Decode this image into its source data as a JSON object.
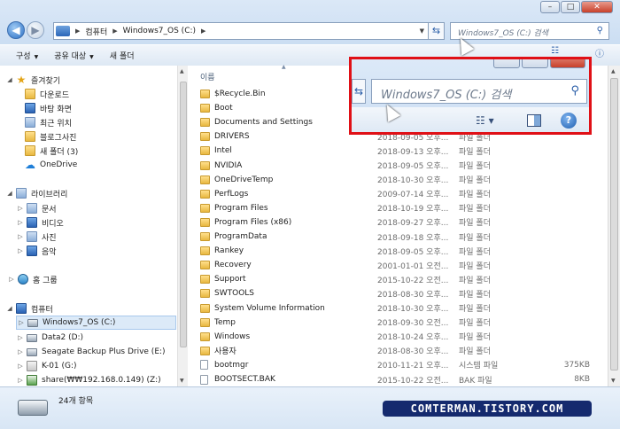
{
  "address_bar": {
    "segments": [
      "컴퓨터",
      "Windows7_OS (C:)"
    ]
  },
  "search": {
    "placeholder": "Windows7_OS (C:) 검색"
  },
  "toolbar": {
    "organize": "구성",
    "share": "공유 대상",
    "new_folder": "새 폴더"
  },
  "sidebar": {
    "favorites_header": "즐겨찾기",
    "favorites": [
      "다운로드",
      "바탕 화면",
      "최근 위치",
      "블로그사진",
      "새 폴더 (3)",
      "OneDrive"
    ],
    "libraries_header": "라이브러리",
    "libraries": [
      "문서",
      "비디오",
      "사진",
      "음악"
    ],
    "homegroup": "홈 그룹",
    "computer_header": "컴퓨터",
    "drives": [
      "Windows7_OS (C:)",
      "Data2 (D:)",
      "Seagate Backup Plus Drive (E:)",
      "K-01 (G:)",
      "share(₩₩192.168.0.149) (Z:)"
    ]
  },
  "file_list": {
    "column_name": "이름",
    "rows": [
      {
        "name": "$Recycle.Bin",
        "date": "",
        "type": "",
        "size": ""
      },
      {
        "name": "Boot",
        "date": "",
        "type": "",
        "size": ""
      },
      {
        "name": "Documents and Settings",
        "date": "",
        "type": "",
        "size": ""
      },
      {
        "name": "DRIVERS",
        "date": "2018-09-05 오후...",
        "type": "파일 폴더",
        "size": ""
      },
      {
        "name": "Intel",
        "date": "2018-09-13 오후...",
        "type": "파일 폴더",
        "size": ""
      },
      {
        "name": "NVIDIA",
        "date": "2018-09-05 오후...",
        "type": "파일 폴더",
        "size": ""
      },
      {
        "name": "OneDriveTemp",
        "date": "2018-10-30 오후...",
        "type": "파일 폴더",
        "size": ""
      },
      {
        "name": "PerfLogs",
        "date": "2009-07-14 오후...",
        "type": "파일 폴더",
        "size": ""
      },
      {
        "name": "Program Files",
        "date": "2018-10-19 오후...",
        "type": "파일 폴더",
        "size": ""
      },
      {
        "name": "Program Files (x86)",
        "date": "2018-09-27 오후...",
        "type": "파일 폴더",
        "size": ""
      },
      {
        "name": "ProgramData",
        "date": "2018-09-18 오후...",
        "type": "파일 폴더",
        "size": ""
      },
      {
        "name": "Rankey",
        "date": "2018-09-05 오후...",
        "type": "파일 폴더",
        "size": ""
      },
      {
        "name": "Recovery",
        "date": "2001-01-01 오전...",
        "type": "파일 폴더",
        "size": ""
      },
      {
        "name": "Support",
        "date": "2015-10-22 오전...",
        "type": "파일 폴더",
        "size": ""
      },
      {
        "name": "SWTOOLS",
        "date": "2018-08-30 오후...",
        "type": "파일 폴더",
        "size": ""
      },
      {
        "name": "System Volume Information",
        "date": "2018-10-30 오후...",
        "type": "파일 폴더",
        "size": ""
      },
      {
        "name": "Temp",
        "date": "2018-09-30 오전...",
        "type": "파일 폴더",
        "size": ""
      },
      {
        "name": "Windows",
        "date": "2018-10-24 오후...",
        "type": "파일 폴더",
        "size": ""
      },
      {
        "name": "사용자",
        "date": "2018-08-30 오후...",
        "type": "파일 폴더",
        "size": ""
      },
      {
        "name": "bootmgr",
        "date": "2010-11-21 오후...",
        "type": "시스템 파일",
        "size": "375KB"
      },
      {
        "name": "BOOTSECT.BAK",
        "date": "2015-10-22 오전...",
        "type": "BAK 파일",
        "size": "8KB"
      }
    ]
  },
  "status": {
    "item_count": "24개 항목"
  },
  "zoom_inset": {
    "search_placeholder": "Windows7_OS (C:) 검색"
  },
  "watermark": "COMTERMAN.TISTORY.COM",
  "colors": {
    "highlight_border": "#e01016",
    "chrome": "#cddff3",
    "selection": "#dceaf8"
  },
  "icons": [
    "back-arrow-icon",
    "forward-arrow-icon",
    "computer-icon",
    "refresh-icon",
    "search-icon",
    "folder-icon",
    "drive-icon",
    "help-icon",
    "views-icon",
    "preview-pane-icon"
  ]
}
